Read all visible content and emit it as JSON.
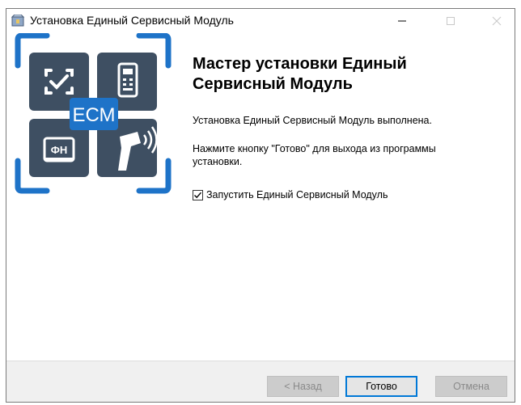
{
  "window": {
    "title": "Установка Единый Сервисный Модуль",
    "icon": "installer-app-icon"
  },
  "titlebar_buttons": {
    "minimize": "minimize-icon",
    "maximize": "maximize-icon",
    "close": "close-icon"
  },
  "logo": {
    "text": "ЕСМ",
    "fn_text": "ФН",
    "icons": [
      "check-scan-icon",
      "cash-register-icon",
      "fiscal-drive-icon",
      "barcode-scanner-icon"
    ]
  },
  "main": {
    "heading": "Мастер установки Единый Сервисный Модуль",
    "message": "Установка Единый Сервисный Модуль выполнена.",
    "instruction": "Нажмите кнопку \"Готово\" для выхода из программы установки.",
    "launch_checkbox": {
      "label": "Запустить Единый Сервисный Модуль",
      "checked": true
    }
  },
  "footer": {
    "back_label": "< Назад",
    "finish_label": "Готово",
    "cancel_label": "Отмена"
  },
  "colors": {
    "brand_blue": "#1e73c8",
    "tile_gray": "#3e4f62",
    "focus_blue": "#0078d7"
  }
}
